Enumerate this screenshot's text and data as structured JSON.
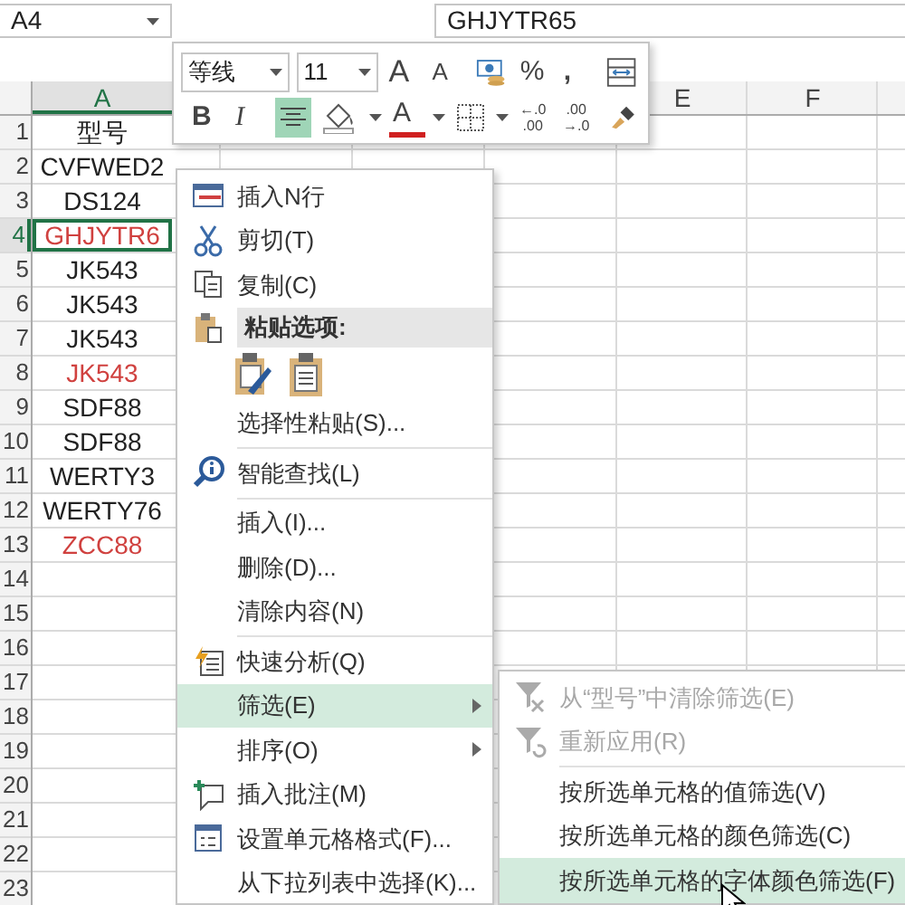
{
  "name_box": {
    "value": "A4"
  },
  "formula_bar": {
    "value": "GHJYTR65"
  },
  "columns": [
    {
      "label": "A",
      "selected": true
    },
    {
      "label": "E",
      "selected": false
    },
    {
      "label": "F",
      "selected": false
    }
  ],
  "rows": [
    {
      "number": "1",
      "cell_a": "型号",
      "color": "#222222",
      "selected": false
    },
    {
      "number": "2",
      "cell_a": "CVFWED2",
      "color": "#222222",
      "selected": false
    },
    {
      "number": "3",
      "cell_a": "DS124",
      "color": "#222222",
      "selected": false
    },
    {
      "number": "4",
      "cell_a": "GHJYTR6",
      "color": "#d0413f",
      "selected": true
    },
    {
      "number": "5",
      "cell_a": "JK543",
      "color": "#222222",
      "selected": false
    },
    {
      "number": "6",
      "cell_a": "JK543",
      "color": "#222222",
      "selected": false
    },
    {
      "number": "7",
      "cell_a": "JK543",
      "color": "#222222",
      "selected": false
    },
    {
      "number": "8",
      "cell_a": "JK543",
      "color": "#d0413f",
      "selected": false
    },
    {
      "number": "9",
      "cell_a": "SDF88",
      "color": "#222222",
      "selected": false
    },
    {
      "number": "10",
      "cell_a": "SDF88",
      "color": "#222222",
      "selected": false
    },
    {
      "number": "11",
      "cell_a": "WERTY3",
      "color": "#222222",
      "selected": false
    },
    {
      "number": "12",
      "cell_a": "WERTY76",
      "color": "#222222",
      "selected": false
    },
    {
      "number": "13",
      "cell_a": "ZCC88",
      "color": "#d0413f",
      "selected": false
    },
    {
      "number": "14",
      "selected": false
    },
    {
      "number": "15",
      "selected": false
    },
    {
      "number": "16",
      "selected": false
    },
    {
      "number": "17",
      "selected": false
    },
    {
      "number": "18",
      "selected": false
    },
    {
      "number": "19",
      "selected": false
    },
    {
      "number": "20",
      "selected": false
    },
    {
      "number": "21",
      "selected": false
    },
    {
      "number": "22",
      "selected": false
    },
    {
      "number": "23",
      "selected": false
    }
  ],
  "mini_toolbar": {
    "font_name": "等线",
    "font_size": "11",
    "row_1": [
      {
        "kind": "grow-font",
        "label": "A",
        "selected": false
      },
      {
        "kind": "shrink-font",
        "label": "A",
        "selected": false
      },
      {
        "kind": "accounting",
        "selected": false
      },
      {
        "kind": "percent",
        "label": "%",
        "selected": false
      },
      {
        "kind": "comma",
        "label": ",",
        "selected": false
      },
      {
        "kind": "merge",
        "selected": false
      }
    ],
    "row_2": [
      {
        "kind": "bold",
        "label": "B",
        "selected": false
      },
      {
        "kind": "italic",
        "label": "I",
        "selected": false
      },
      {
        "kind": "align-center",
        "selected": true
      },
      {
        "kind": "fill-color",
        "selected": false
      },
      {
        "kind": "font-color",
        "label": "A",
        "selected": false
      },
      {
        "kind": "borders",
        "selected": false
      },
      {
        "kind": "decrease-decimal",
        "lines": [
          "←.0",
          ".00"
        ],
        "selected": false
      },
      {
        "kind": "increase-decimal",
        "lines": [
          ".00",
          "→.0"
        ],
        "selected": false
      },
      {
        "kind": "format-painter",
        "selected": false
      }
    ]
  },
  "context_menu": [
    {
      "kind": "insert-row",
      "label": "插入N行",
      "selected": false
    },
    {
      "kind": "cut",
      "label": "剪切(T)",
      "selected": false
    },
    {
      "kind": "copy",
      "label": "复制(C)",
      "selected": false
    },
    {
      "kind": "paste-header",
      "label": "粘贴选项:"
    },
    {
      "kind": "paste-options"
    },
    {
      "kind": "plain",
      "label": "选择性粘贴(S)...",
      "selected": false
    },
    {
      "kind": "separator"
    },
    {
      "kind": "smart-lookup",
      "label": "智能查找(L)",
      "selected": false
    },
    {
      "kind": "separator"
    },
    {
      "kind": "plain",
      "label": "插入(I)...",
      "selected": false
    },
    {
      "kind": "plain",
      "label": "删除(D)...",
      "selected": false
    },
    {
      "kind": "plain",
      "label": "清除内容(N)",
      "selected": false
    },
    {
      "kind": "separator"
    },
    {
      "kind": "quick-analysis",
      "label": "快速分析(Q)",
      "selected": false
    },
    {
      "kind": "submenu",
      "label": "筛选(E)",
      "selected": true
    },
    {
      "kind": "submenu",
      "label": "排序(O)",
      "selected": false
    },
    {
      "kind": "comment",
      "label": "插入批注(M)",
      "selected": false
    },
    {
      "kind": "format-cells",
      "label": "设置单元格格式(F)...",
      "selected": false
    },
    {
      "kind": "plain",
      "label": "从下拉列表中选择(K)...",
      "selected": false
    }
  ],
  "submenu": [
    {
      "kind": "clear-filter",
      "label": "从“型号”中清除筛选(E)",
      "disabled": true,
      "selected": false
    },
    {
      "kind": "reapply",
      "label": "重新应用(R)",
      "disabled": true,
      "selected": false
    },
    {
      "kind": "separator"
    },
    {
      "kind": "plain",
      "label": "按所选单元格的值筛选(V)",
      "disabled": false,
      "selected": false
    },
    {
      "kind": "plain",
      "label": "按所选单元格的颜色筛选(C)",
      "disabled": false,
      "selected": false
    },
    {
      "kind": "plain",
      "label": "按所选单元格的字体颜色筛选(F)",
      "disabled": false,
      "selected": true
    }
  ]
}
